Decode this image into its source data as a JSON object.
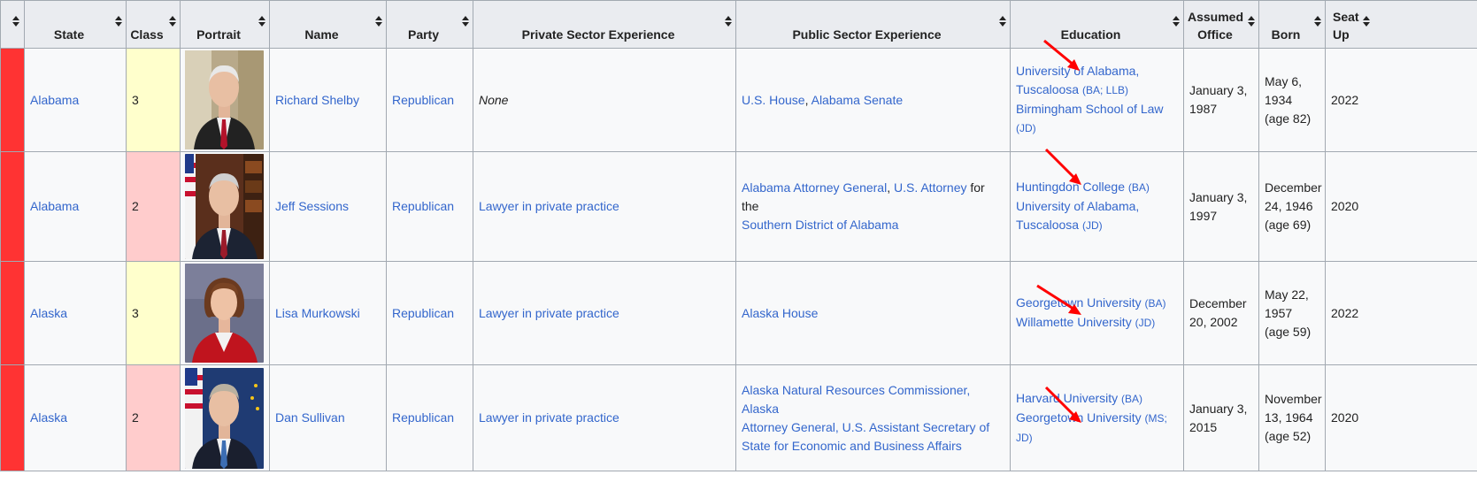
{
  "headers": {
    "color": "",
    "state": "State",
    "class": "Class",
    "portrait": "Portrait",
    "name": "Name",
    "party": "Party",
    "private": "Private Sector Experience",
    "public": "Public Sector Experience",
    "education": "Education",
    "assumed_line1": "Assumed",
    "assumed_line2": "Office",
    "born": "Born",
    "seat_line1": "Seat",
    "seat_line2": "Up"
  },
  "colors": {
    "party_republican": "#ff3333",
    "class3_bg": "#ffffcc",
    "class2_bg": "#ffcccc",
    "link": "#3366cc",
    "arrow": "#ff0000"
  },
  "rows": [
    {
      "state": "Alabama",
      "class": "3",
      "name": "Richard Shelby",
      "party": "Republican",
      "private": "None",
      "public_links": [
        "U.S. House",
        "Alabama Senate"
      ],
      "public_sep": ", ",
      "education": [
        {
          "name_line1": "University of Alabama,",
          "name_line2": "Tuscaloosa",
          "degrees": "(BA; LLB)"
        },
        {
          "name": "Birmingham School of Law",
          "degrees": "(JD)"
        }
      ],
      "assumed_line1": "January 3,",
      "assumed_line2": "1987",
      "born_line1": "May 6,",
      "born_line2": "1934",
      "born_line3": "(age 82)",
      "seat_up": "2022",
      "portrait_icon": "portrait-richard-shelby"
    },
    {
      "state": "Alabama",
      "class": "2",
      "name": "Jeff Sessions",
      "party": "Republican",
      "private": "Lawyer in private practice",
      "public_link1": "Alabama Attorney General",
      "public_sep": ", ",
      "public_link2": "U.S. Attorney",
      "public_text": " for the",
      "public_link3": "Southern District of Alabama",
      "education": [
        {
          "name": "Huntingdon College",
          "degrees": "(BA)"
        },
        {
          "name_line1": "University of Alabama,",
          "name_line2": "Tuscaloosa",
          "degrees": "(JD)"
        }
      ],
      "assumed_line1": "January 3,",
      "assumed_line2": "1997",
      "born_line1": "December",
      "born_line2": "24, 1946",
      "born_line3": "(age 69)",
      "seat_up": "2020",
      "portrait_icon": "portrait-jeff-sessions"
    },
    {
      "state": "Alaska",
      "class": "3",
      "name": "Lisa Murkowski",
      "party": "Republican",
      "private": "Lawyer in private practice",
      "public_link1": "Alaska House",
      "education": [
        {
          "name": "Georgetown University",
          "degrees": "(BA)"
        },
        {
          "name": "Willamette University",
          "degrees": "(JD)"
        }
      ],
      "assumed_line1": "December",
      "assumed_line2": "20, 2002",
      "born_line1": "May 22,",
      "born_line2": "1957",
      "born_line3": "(age 59)",
      "seat_up": "2022",
      "portrait_icon": "portrait-lisa-murkowski"
    },
    {
      "state": "Alaska",
      "class": "2",
      "name": "Dan Sullivan",
      "party": "Republican",
      "private": "Lawyer in private practice",
      "public_line1": "Alaska Natural Resources Commissioner, Alaska",
      "public_line2": "Attorney General, U.S. Assistant Secretary of",
      "public_line3": "State for Economic and Business Affairs",
      "education": [
        {
          "name": "Harvard University",
          "degrees": "(BA)"
        },
        {
          "name": "Georgetown University",
          "degrees": "(MS; JD)"
        }
      ],
      "assumed_line1": "January 3,",
      "assumed_line2": "2015",
      "born_line1": "November",
      "born_line2": "13, 1964",
      "born_line3": "(age 52)",
      "seat_up": "2020",
      "portrait_icon": "portrait-dan-sullivan"
    }
  ]
}
